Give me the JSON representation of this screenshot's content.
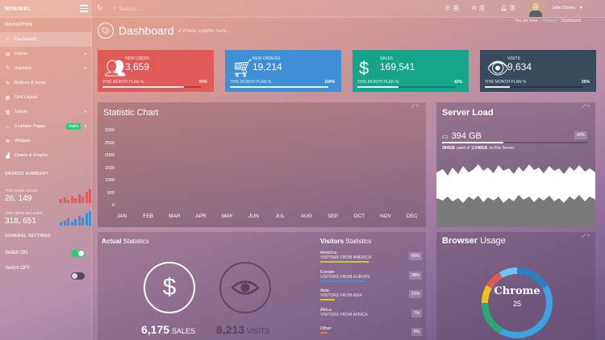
{
  "brand": {
    "bold": "MIN",
    "rest": "IMAL"
  },
  "topbar": {
    "search_placeholder": "Search ...",
    "messages_count": "2",
    "mail_count": "1",
    "notif_count": "3",
    "user_name": "John Douey"
  },
  "sidebar": {
    "navigation_title": "NAVIGATION",
    "items": [
      {
        "label": "Dashboard",
        "icon": "home-icon"
      },
      {
        "label": "Forms",
        "icon": "file-icon"
      },
      {
        "label": "Interface",
        "icon": "bolt-icon"
      },
      {
        "label": "Buttons & Icons",
        "icon": "brush-icon"
      },
      {
        "label": "Grid Layout",
        "icon": "grid-icon"
      },
      {
        "label": "Tables",
        "icon": "table-icon"
      },
      {
        "label": "Example Pages",
        "icon": "monitor-icon",
        "badge": "mailx"
      },
      {
        "label": "Widgets",
        "icon": "gear-icon"
      },
      {
        "label": "Charts & Graphs",
        "icon": "chart-icon"
      }
    ],
    "orders_title": "ORDERS SUMMARY",
    "week_sales_label": "THIS WEEK SALES",
    "week_sales_value": "26, 149",
    "week_balance_label": "THIS WEEK BALANCE",
    "week_balance_value": "318, 651",
    "settings_title": "GENERAL SETTINGS",
    "switch_on_label": "Switch ON",
    "switch_off_label": "Switch OFF"
  },
  "page": {
    "title": "Dashboard",
    "subtitle": "// Place subtitle here...",
    "breadcrumb_prefix": "You are here",
    "breadcrumb_home": "Minimal",
    "breadcrumb_current": "Dashboard"
  },
  "stats": [
    {
      "label": "NEW USERS",
      "value": "3,659",
      "plan": "THIS MONTH PLAN %",
      "percent": "83%",
      "fill": 0.83,
      "color": "#e05a57",
      "icon": "users-icon"
    },
    {
      "label": "NEW ORDERS",
      "value": "19,214",
      "plan": "THIS MONTH PLAN %",
      "percent": "100%",
      "fill": 1.0,
      "color": "#3e8fd6",
      "icon": "cart-icon"
    },
    {
      "label": "SALES",
      "value": "169,541",
      "plan": "THIS MONTH PLAN %",
      "percent": "42%",
      "fill": 0.42,
      "color": "#17a589",
      "icon": "dollar-icon"
    },
    {
      "label": "VISITS",
      "value": "9,634",
      "plan": "THIS MONTH PLAN %",
      "percent": "25%",
      "fill": 0.25,
      "color": "#384a5e",
      "icon": "eye-icon"
    }
  ],
  "statistic_chart": {
    "title": "Statistic Chart",
    "yticks": [
      "3000",
      "2500",
      "2000",
      "1500",
      "1000",
      "500",
      "0"
    ],
    "months": [
      "JAN",
      "FEB",
      "MAR",
      "APR",
      "MAY",
      "JUN",
      "JUL",
      "AUG",
      "SEP",
      "OCT",
      "NOV",
      "DEC"
    ]
  },
  "server_load": {
    "title": "Server Load",
    "value": "394 GB",
    "percent": "42%",
    "used": "394GB",
    "total": "2,048GB",
    "used_text_mid": "used of",
    "used_text_end": "on File Server"
  },
  "actual_statistics": {
    "title_bold": "Actual",
    "title_rest": " Statistics",
    "sales_value": "6,175",
    "sales_label": "SALES",
    "visits_value": "8,213",
    "visits_label": "VISITS"
  },
  "visitors_statistics": {
    "title_bold": "Visitors",
    "title_rest": " Statistics",
    "items": [
      {
        "name": "America",
        "sub": "VISITORS FROM AMERICA",
        "percent": "40%",
        "fill": 0.4,
        "color": "#b5d334"
      },
      {
        "name": "Europe",
        "sub": "VISITORS FROM EUROPE",
        "percent": "38%",
        "fill": 0.38,
        "color": "#3e8fd6"
      },
      {
        "name": "Asia",
        "sub": "VISITORS FROM ASIA",
        "percent": "12%",
        "fill": 0.12,
        "color": "#f1c40f"
      },
      {
        "name": "Africa",
        "sub": "VISITORS FROM AFRICA",
        "percent": "7%",
        "fill": 0.07,
        "color": "#9b59b6"
      },
      {
        "name": "Other",
        "sub": "",
        "percent": "6%",
        "fill": 0.06,
        "color": "#e67e22"
      }
    ]
  },
  "browser_usage": {
    "title_bold": "Browser",
    "title_rest": " Usage",
    "center_label": "Chrome",
    "center_value": "25"
  }
}
